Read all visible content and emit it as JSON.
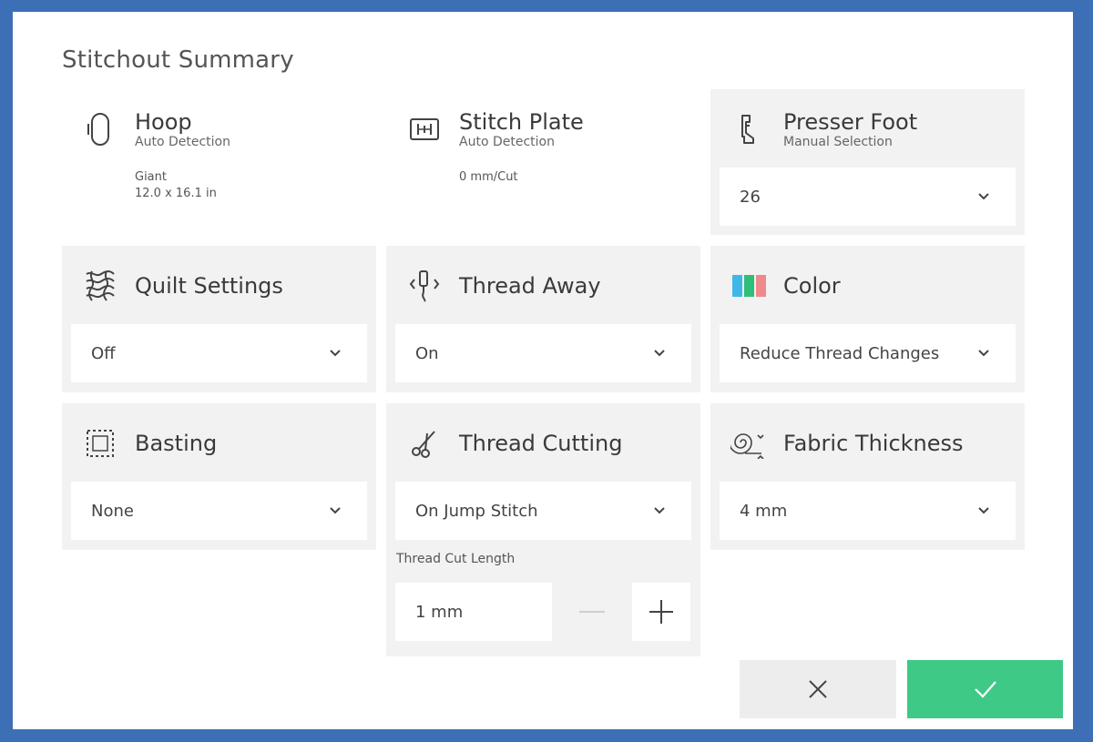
{
  "title": "Stitchout Summary",
  "hoop": {
    "title": "Hoop",
    "subtitle": "Auto Detection",
    "line1": "Giant",
    "line2": "12.0 x 16.1 in",
    "icon": "hoop-icon"
  },
  "stitch_plate": {
    "title": "Stitch Plate",
    "subtitle": "Auto Detection",
    "line1": "0 mm/Cut",
    "icon": "stitch-plate-icon"
  },
  "presser_foot": {
    "title": "Presser Foot",
    "subtitle": "Manual Selection",
    "value": "26",
    "icon": "presser-foot-icon"
  },
  "quilt_settings": {
    "title": "Quilt Settings",
    "value": "Off",
    "icon": "quilt-icon"
  },
  "thread_away": {
    "title": "Thread Away",
    "value": "On",
    "icon": "thread-away-icon"
  },
  "color": {
    "title": "Color",
    "value": "Reduce Thread Changes",
    "icon": "color-bars-icon",
    "swatches": [
      "#3fb8e8",
      "#2fbf7a",
      "#f08a8a"
    ]
  },
  "basting": {
    "title": "Basting",
    "value": "None",
    "icon": "basting-icon"
  },
  "thread_cutting": {
    "title": "Thread Cutting",
    "value": "On Jump Stitch",
    "icon": "scissors-icon",
    "length_label": "Thread Cut Length",
    "length_value": "1 mm"
  },
  "fabric_thickness": {
    "title": "Fabric Thickness",
    "value": "4 mm",
    "icon": "fabric-roll-icon"
  },
  "colors": {
    "background": "#3d6fb6",
    "panel": "#f2f2f2",
    "confirm": "#3ec986",
    "cancel_bg": "#ededed"
  }
}
